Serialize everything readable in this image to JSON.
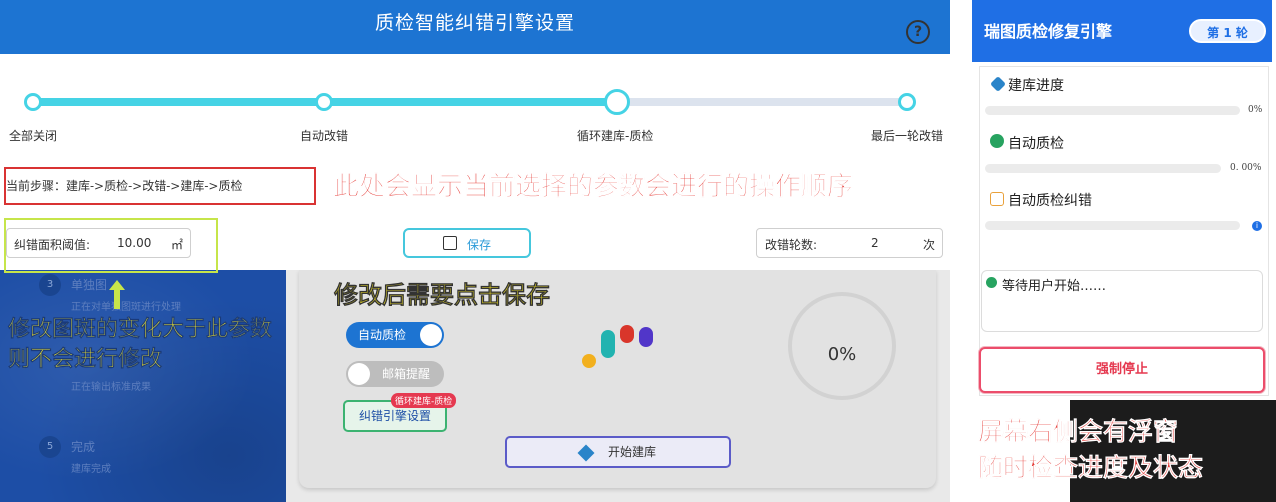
{
  "dialog": {
    "title": "质检智能纠错引擎设置",
    "help_icon": "question-circle-icon",
    "steps": [
      {
        "label": "全部关闭"
      },
      {
        "label": "自动改错"
      },
      {
        "label": "循环建库-质检"
      },
      {
        "label": "最后一轮改错"
      }
    ],
    "selected_step_index": 2,
    "current_steps_text": "当前步骤：建库->质检->改错->建库->质检",
    "area_threshold": {
      "label": "纠错面积阈值:",
      "value": "10.00",
      "unit": "㎡"
    },
    "save_label": "保存",
    "save_icon": "save-icon",
    "rounds": {
      "label": "改错轮数:",
      "value": "2",
      "unit": "次"
    }
  },
  "background_app": {
    "steps": [
      {
        "num": "3",
        "title": "单独图",
        "sub": "正在对单独图斑进行处理"
      },
      {
        "num": "4",
        "title": "",
        "sub": "正在输出标准成果"
      },
      {
        "num": "5",
        "title": "完成",
        "sub": "建库完成"
      }
    ],
    "toggle_auto_qc": "自动质检",
    "toggle_mail": "邮箱提醒",
    "engine_settings_button": "纠错引擎设置",
    "engine_badge": "循环建库-质检",
    "start_button": "开始建库",
    "progress_text": "0%"
  },
  "float_panel": {
    "title": "瑞图质检修复引擎",
    "round_badge": "第 1 轮",
    "items": [
      {
        "label": "建库进度",
        "icon": "cube-icon",
        "percent_text": "0%",
        "progress": 0
      },
      {
        "label": "自动质检",
        "icon": "search-icon",
        "percent_text": "0. 00%",
        "progress": 0
      },
      {
        "label": "自动质检纠错",
        "icon": "edit-icon",
        "percent_text": "",
        "progress": 0
      }
    ],
    "message": "等待用户开始……",
    "stop_button": "强制停止"
  },
  "annotations": {
    "steps_note": "此处会显示当前选择的参数会进行的操作顺序",
    "save_note": "修改后需要点击保存",
    "threshold_note_line1": "修改图斑的变化大于此参数",
    "threshold_note_line2": "则不会进行修改",
    "panel_note_line1": "屏幕右侧会有浮窗",
    "panel_note_line2": "随时检查进度及状态"
  },
  "colors": {
    "header_blue": "#1d74d2",
    "track_cyan": "#45d3e5",
    "annotation_red": "#e53935",
    "annotation_yellow": "#f4e426",
    "panel_blue": "#1f6fe5",
    "stop_red": "#e53950"
  }
}
